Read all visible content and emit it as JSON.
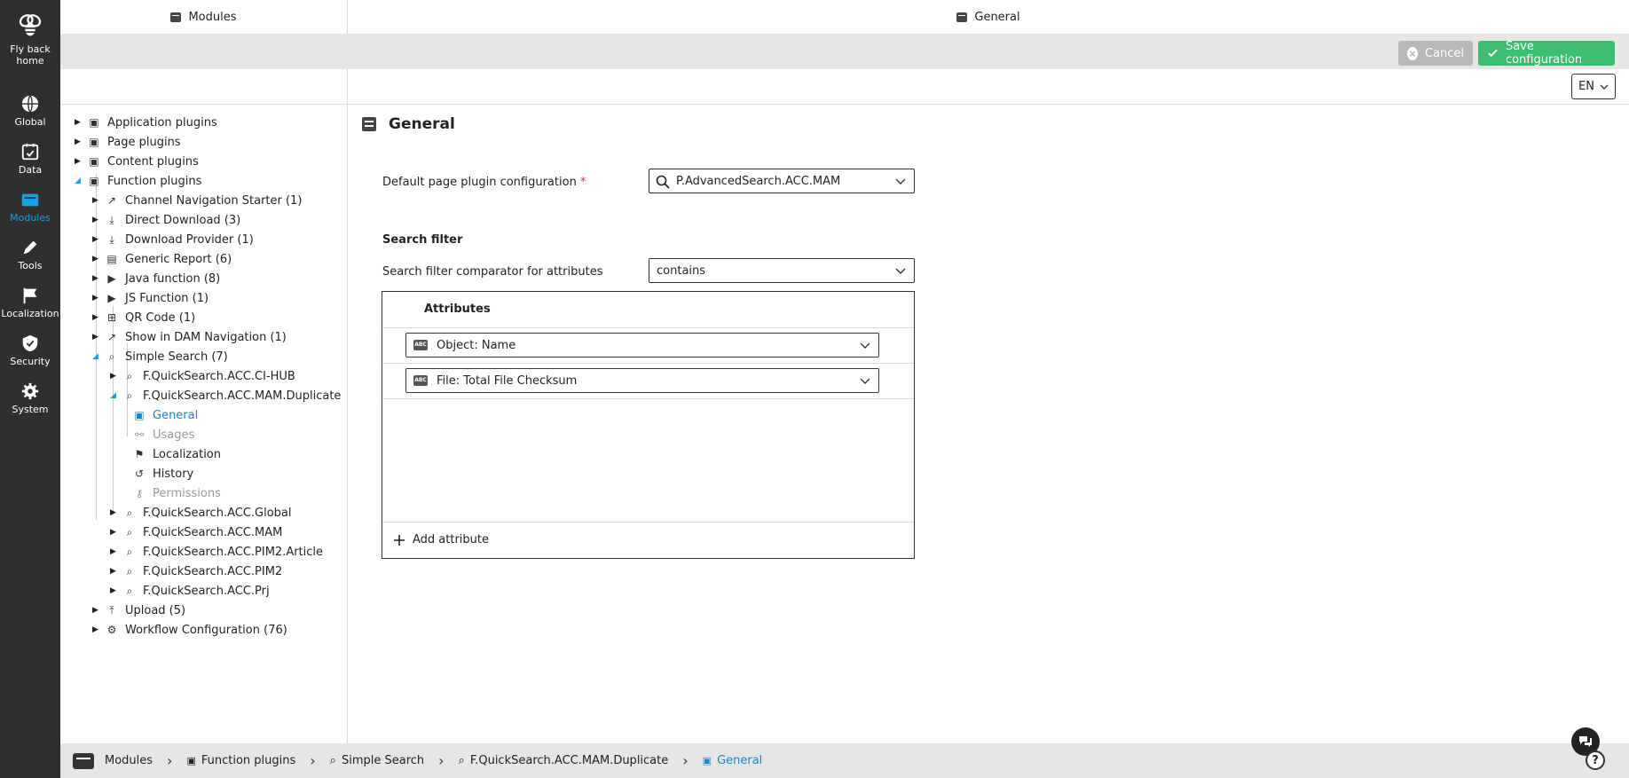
{
  "rail": {
    "home_label_1": "Fly back",
    "home_label_2": "home",
    "items": [
      {
        "label": "Global",
        "icon": "globe-icon"
      },
      {
        "label": "Data",
        "icon": "data-icon"
      },
      {
        "label": "Modules",
        "icon": "modules-icon"
      },
      {
        "label": "Tools",
        "icon": "pencil-icon"
      },
      {
        "label": "Localization",
        "icon": "flag-icon"
      },
      {
        "label": "Security",
        "icon": "shield-icon"
      },
      {
        "label": "System",
        "icon": "gear-icon"
      }
    ],
    "active_color": "#1aa0e0"
  },
  "header": {
    "left_title": "Modules",
    "right_title": "General"
  },
  "toolbar": {
    "cancel_label": "Cancel",
    "save_label": "Save configuration",
    "save_color": "#3cbd6f"
  },
  "language": {
    "value": "EN"
  },
  "tree": {
    "items": [
      {
        "label": "Application plugins",
        "icon": "app-plugin-icon"
      },
      {
        "label": "Page plugins",
        "icon": "page-plugin-icon"
      },
      {
        "label": "Content plugins",
        "icon": "content-plugin-icon"
      },
      {
        "label": "Function plugins",
        "icon": "function-plugin-icon"
      },
      {
        "label": "Channel Navigation Starter (1)",
        "icon": "external-link-icon"
      },
      {
        "label": "Direct Download (3)",
        "icon": "download-icon"
      },
      {
        "label": "Download Provider (1)",
        "icon": "download-icon"
      },
      {
        "label": "Generic Report (6)",
        "icon": "report-icon"
      },
      {
        "label": "Java function (8)",
        "icon": "play-icon"
      },
      {
        "label": "JS Function (1)",
        "icon": "play-icon"
      },
      {
        "label": "QR Code (1)",
        "icon": "qr-code-icon"
      },
      {
        "label": "Show in DAM Navigation (1)",
        "icon": "external-link-icon"
      },
      {
        "label": "Simple Search (7)",
        "icon": "search-icon"
      },
      {
        "label": "F.QuickSearch.ACC.CI-HUB",
        "icon": "search-icon"
      },
      {
        "label": "F.QuickSearch.ACC.MAM.Duplicate",
        "icon": "search-icon"
      },
      {
        "label": "General",
        "icon": "general-icon"
      },
      {
        "label": "Usages",
        "icon": "usages-icon"
      },
      {
        "label": "Localization",
        "icon": "flag-icon"
      },
      {
        "label": "History",
        "icon": "history-icon"
      },
      {
        "label": "Permissions",
        "icon": "key-icon"
      },
      {
        "label": "F.QuickSearch.ACC.Global",
        "icon": "search-icon"
      },
      {
        "label": "F.QuickSearch.ACC.MAM",
        "icon": "search-icon"
      },
      {
        "label": "F.QuickSearch.ACC.PIM2.Article",
        "icon": "search-icon"
      },
      {
        "label": "F.QuickSearch.ACC.PIM2",
        "icon": "search-icon"
      },
      {
        "label": "F.QuickSearch.ACC.Prj",
        "icon": "search-icon"
      },
      {
        "label": "Upload (5)",
        "icon": "upload-icon"
      },
      {
        "label": "Workflow Configuration (76)",
        "icon": "gear-icon"
      }
    ]
  },
  "main": {
    "title": "General",
    "default_config_label": "Default page plugin configuration",
    "required_mark": "*",
    "default_config_value": "P.AdvancedSearch.ACC.MAM",
    "section_title": "Search filter",
    "comparator_label": "Search filter comparator for attributes",
    "comparator_value": "contains",
    "attributes_header": "Attributes",
    "attributes": [
      {
        "value": "Object: Name",
        "icon": "abc-icon"
      },
      {
        "value": "File: Total File Checksum",
        "icon": "abc-icon"
      }
    ],
    "add_attribute_label": "Add attribute"
  },
  "breadcrumb": {
    "items": [
      {
        "label": "Modules"
      },
      {
        "label": "Function plugins"
      },
      {
        "label": "Simple Search"
      },
      {
        "label": "F.QuickSearch.ACC.MAM.Duplicate"
      },
      {
        "label": "General"
      }
    ]
  }
}
